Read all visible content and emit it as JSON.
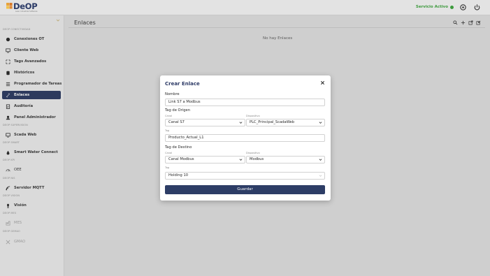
{
  "header": {
    "logo_text": "DeOP",
    "logo_subtitle": "Lean Industrial Software",
    "service_status": "Servicio Activo"
  },
  "sidebar": {
    "sections": [
      {
        "label": "DEOP CONECTIVIDAD"
      },
      {
        "label": "DEOP SUPERVISION"
      },
      {
        "label": "DEOP SMART"
      },
      {
        "label": "DEOP KPI"
      },
      {
        "label": "DEOP NIS"
      },
      {
        "label": "DEOP VISION"
      },
      {
        "label": "DEOP MES"
      },
      {
        "label": "DEOP GEMAO"
      }
    ],
    "items": [
      {
        "label": "Conexiones OT"
      },
      {
        "label": "Cliente Web"
      },
      {
        "label": "Tags Avanzados"
      },
      {
        "label": "Históricos"
      },
      {
        "label": "Programador de Tareas"
      },
      {
        "label": "Enlaces"
      },
      {
        "label": "Auditoría"
      },
      {
        "label": "Panel Administrador"
      },
      {
        "label": "Scada Web"
      },
      {
        "label": "Smart Water Connect"
      },
      {
        "label": "OEE"
      },
      {
        "label": "Servidor MQTT"
      },
      {
        "label": "Visión"
      },
      {
        "label": "MES"
      },
      {
        "label": "GMAO"
      }
    ]
  },
  "main": {
    "title": "Enlaces",
    "empty_message": "No hay Enlaces"
  },
  "modal": {
    "title": "Crear Enlace",
    "name_label": "Nombre",
    "name_value": "Link S7 a Modbus",
    "origin": {
      "heading": "Tag de Origen",
      "canal_label": "Canal",
      "canal_value": "Canal S7",
      "dispositivo_label": "Dispositivo",
      "dispositivo_value": "PLC_Principal_ScadaWeb",
      "tag_label": "Tag",
      "tag_value": "Producto_Actual_L1"
    },
    "dest": {
      "heading": "Tag de Destino",
      "canal_label": "Canal",
      "canal_value": "Canal Modbus",
      "dispositivo_label": "Dispositivo",
      "dispositivo_value": "Modbus",
      "tag_label": "Tag",
      "tag_value": "Holding 10"
    },
    "save_label": "Guardar"
  },
  "colors": {
    "brand": "#2d3a66",
    "active": "#2d3a5d",
    "status": "#3d9a3d"
  },
  "icons": {
    "header": [
      "settings-icon",
      "power-icon"
    ],
    "toolbar": [
      "search-icon",
      "add-icon",
      "export-icon",
      "import-icon"
    ]
  }
}
